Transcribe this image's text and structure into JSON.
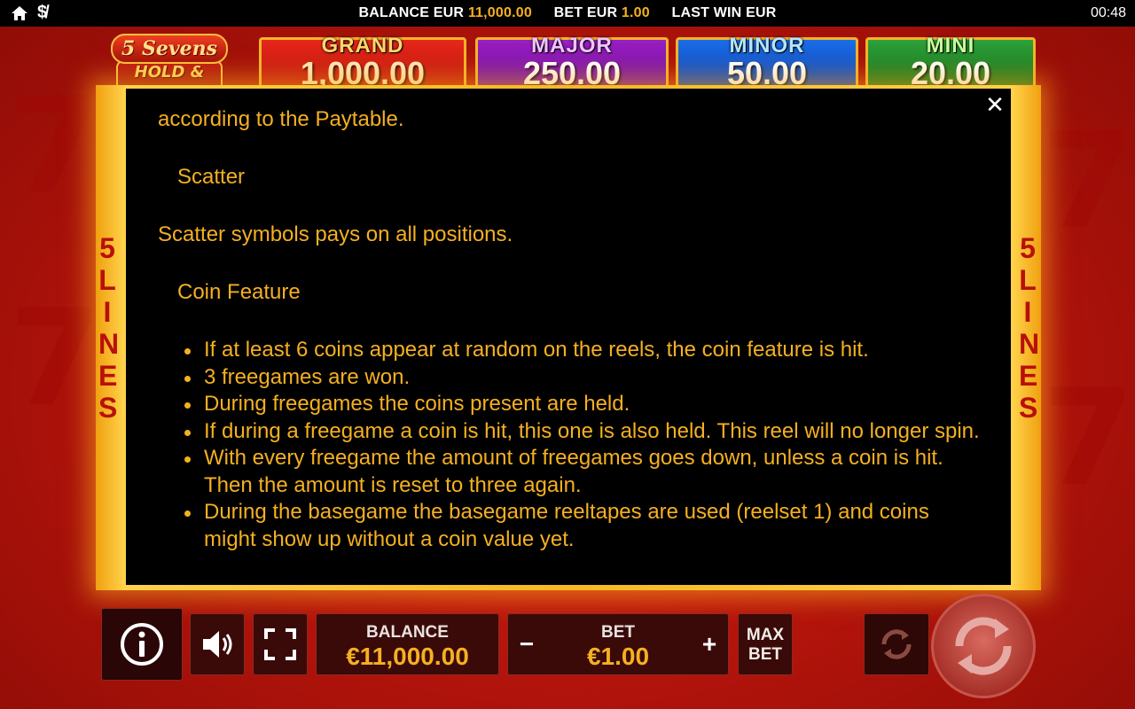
{
  "status_bar": {
    "balance_label": "BALANCE EUR",
    "balance_value": "11,000.00",
    "bet_label": "BET EUR",
    "bet_value": "1.00",
    "last_win_label": "LAST WIN EUR",
    "clock": "00:48",
    "icons": [
      "home-icon",
      "mute-dollar-icon"
    ]
  },
  "logo": {
    "line1": "5 Sevens",
    "line2": "HOLD & WIN"
  },
  "jackpots": [
    {
      "name": "GRAND",
      "amount": "1,000.00",
      "color": "#d41c12"
    },
    {
      "name": "MAJOR",
      "amount": "250.00",
      "color": "#8a16b8"
    },
    {
      "name": "MINOR",
      "amount": "50.00",
      "color": "#1656d6"
    },
    {
      "name": "MINI",
      "amount": "20.00",
      "color": "#1f8a2c"
    }
  ],
  "side_label": "5 LINES",
  "paytable": {
    "intro": "according to the Paytable.",
    "scatter_heading": "Scatter",
    "scatter_text": "Scatter symbols pays on all positions.",
    "coin_heading": "Coin Feature",
    "coin_items": [
      "If at least 6 coins appear at random on the reels, the coin feature is hit.",
      "3 freegames are won.",
      "During freegames the coins present are held.",
      "If during a freegame a coin is hit, this one is also held. This reel will no longer spin.",
      "With every freegame the amount of freegames goes down, unless a coin is hit. Then the amount is reset to three again.",
      "During the basegame the basegame reeltapes are used (reelset 1) and coins might show up without a coin value yet."
    ],
    "close_symbol": "✕"
  },
  "controls": {
    "balance_label": "BALANCE",
    "balance_value": "€11,000.00",
    "bet_label": "BET",
    "bet_value": "€1.00",
    "bet_minus": "−",
    "bet_plus": "+",
    "maxbet_line1": "MAX",
    "maxbet_line2": "BET"
  },
  "colors": {
    "accent_gold": "#f5b021",
    "background_red": "#c0180e",
    "panel": "#000000"
  }
}
